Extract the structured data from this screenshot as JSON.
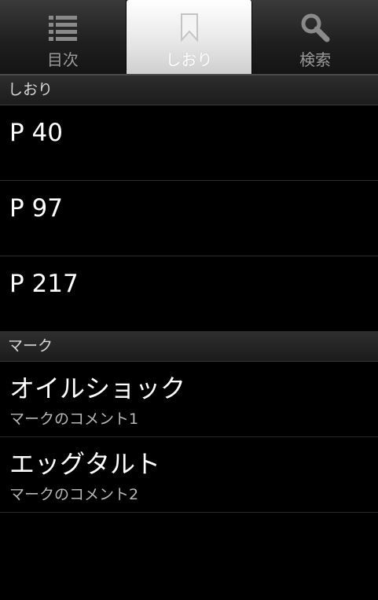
{
  "tabs": [
    {
      "label": "目次",
      "icon": "list-icon"
    },
    {
      "label": "しおり",
      "icon": "bookmark-icon"
    },
    {
      "label": "検索",
      "icon": "search-icon"
    }
  ],
  "active_tab": "しおり",
  "bookmarks": {
    "header": "しおり",
    "items": [
      {
        "title": "P 40"
      },
      {
        "title": "P 97"
      },
      {
        "title": "P 217"
      }
    ]
  },
  "marks": {
    "header": "マーク",
    "items": [
      {
        "title": "オイルショック",
        "comment": "マークのコメント1"
      },
      {
        "title": "エッグタルト",
        "comment": "マークのコメント2"
      }
    ]
  },
  "colors": {
    "background": "#000000",
    "active_tab": "#ffffff",
    "inactive_icon": "#8a8a8a"
  }
}
